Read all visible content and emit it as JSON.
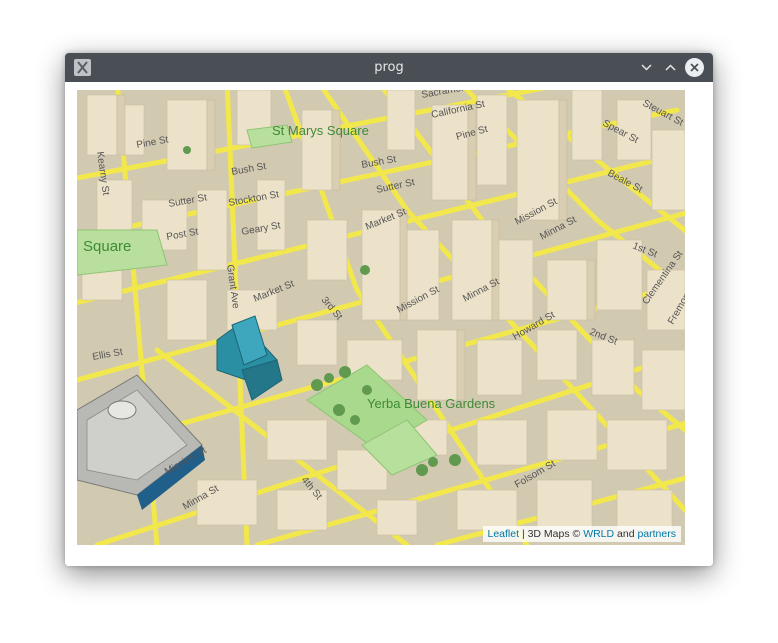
{
  "window": {
    "title": "prog",
    "buttons": {
      "minimize": "minimize-button",
      "maximize": "maximize-button",
      "close": "close-button"
    }
  },
  "map": {
    "park_labels": {
      "st_marys_square": "St Marys Square",
      "yerba_buena_gardens": "Yerba Buena Gardens",
      "square": "Square"
    },
    "street_labels": {
      "sacramento": "Sacramento",
      "california": "California St",
      "pine": "Pine St",
      "spear": "Spear St",
      "steuart": "Steuart St",
      "bush": "Bush St",
      "sutter": "Sutter St",
      "sutter_w": "Sutter St",
      "post": "Post St",
      "geary": "Geary St",
      "market": "Market St",
      "market_w": "Market St",
      "mission": "Mission St",
      "mission_w": "Mission St",
      "minna": "Minna St",
      "minna_w": "Minna St",
      "beale": "Beale St",
      "first": "1st St",
      "second": "2nd St",
      "third": "3rd St",
      "fourth": "4th St",
      "howard": "Howard St",
      "folsom": "Folsom St",
      "ellis": "Ellis St",
      "grant": "Grant Ave",
      "clementina": "Clementina St",
      "pine_w": "Pine St",
      "bush_w": "Bush St",
      "stockton": "Stockton St",
      "fremont": "Fremont St",
      "kearny": "Kearny St"
    }
  },
  "attribution": {
    "leaflet": "Leaflet",
    "sep": " | 3D Maps © ",
    "wrld": "WRLD",
    "and": " and ",
    "partners": "partners"
  },
  "colors": {
    "titlebar": "#4a4f55",
    "road": "#f4e84a",
    "ground": "#d4cbb4",
    "building": "#e8dcc2",
    "park": "#a6d88a",
    "teal_tower": "#2b8fa4"
  }
}
